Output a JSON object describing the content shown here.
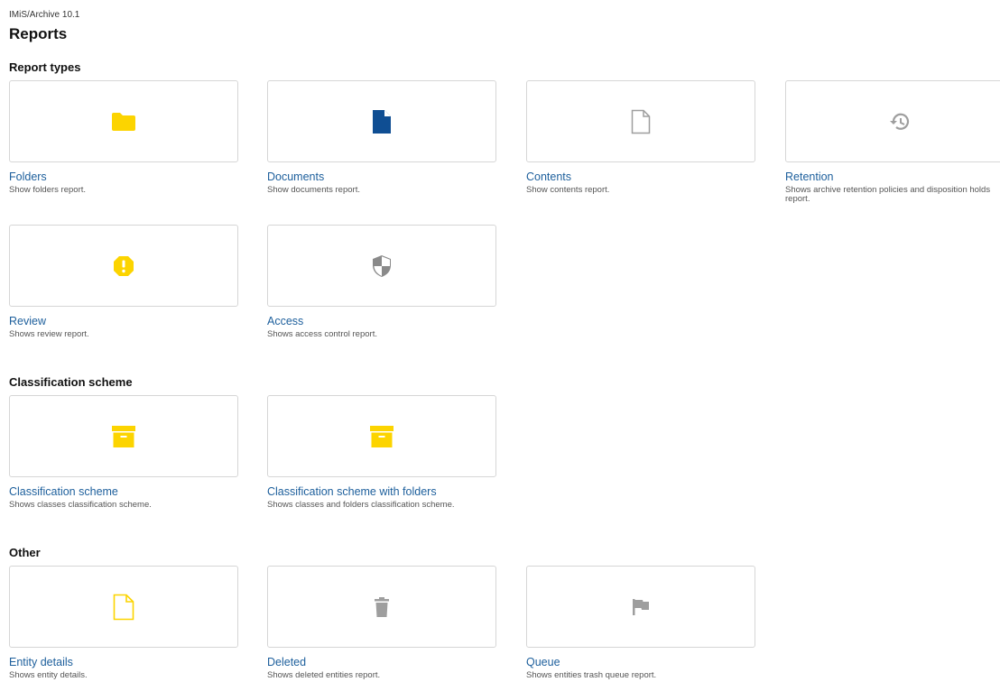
{
  "header": {
    "app_title": "IMiS/Archive 10.1",
    "page_title": "Reports"
  },
  "sections": {
    "report_types": {
      "title": "Report types",
      "cards": [
        {
          "title": "Folders",
          "description": "Show folders report.",
          "icon": "folder-icon",
          "color": "#fcd400"
        },
        {
          "title": "Documents",
          "description": "Show documents report.",
          "icon": "document-icon",
          "color": "#0f4e93"
        },
        {
          "title": "Contents",
          "description": "Show contents report.",
          "icon": "file-outline-icon",
          "color": "#9e9e9e"
        },
        {
          "title": "Retention",
          "description": "Shows archive retention policies and disposition holds report.",
          "icon": "history-icon",
          "color": "#9e9e9e"
        },
        {
          "title": "Review",
          "description": "Shows review report.",
          "icon": "alert-icon",
          "color": "#fcd400"
        },
        {
          "title": "Access",
          "description": "Shows access control report.",
          "icon": "shield-icon",
          "color": "#8a8a8a"
        }
      ]
    },
    "classification": {
      "title": "Classification scheme",
      "cards": [
        {
          "title": "Classification scheme",
          "description": "Shows classes classification scheme.",
          "icon": "archive-box-icon",
          "color": "#fcd400"
        },
        {
          "title": "Classification scheme with folders",
          "description": "Shows classes and folders classification scheme.",
          "icon": "archive-box-icon",
          "color": "#fcd400"
        }
      ]
    },
    "other": {
      "title": "Other",
      "cards": [
        {
          "title": "Entity details",
          "description": "Shows entity details.",
          "icon": "file-outline-icon",
          "color": "#fcd400"
        },
        {
          "title": "Deleted",
          "description": "Shows deleted entities report.",
          "icon": "trash-icon",
          "color": "#9e9e9e"
        },
        {
          "title": "Queue",
          "description": "Shows entities trash queue report.",
          "icon": "flag-icon",
          "color": "#9e9e9e"
        }
      ]
    }
  }
}
